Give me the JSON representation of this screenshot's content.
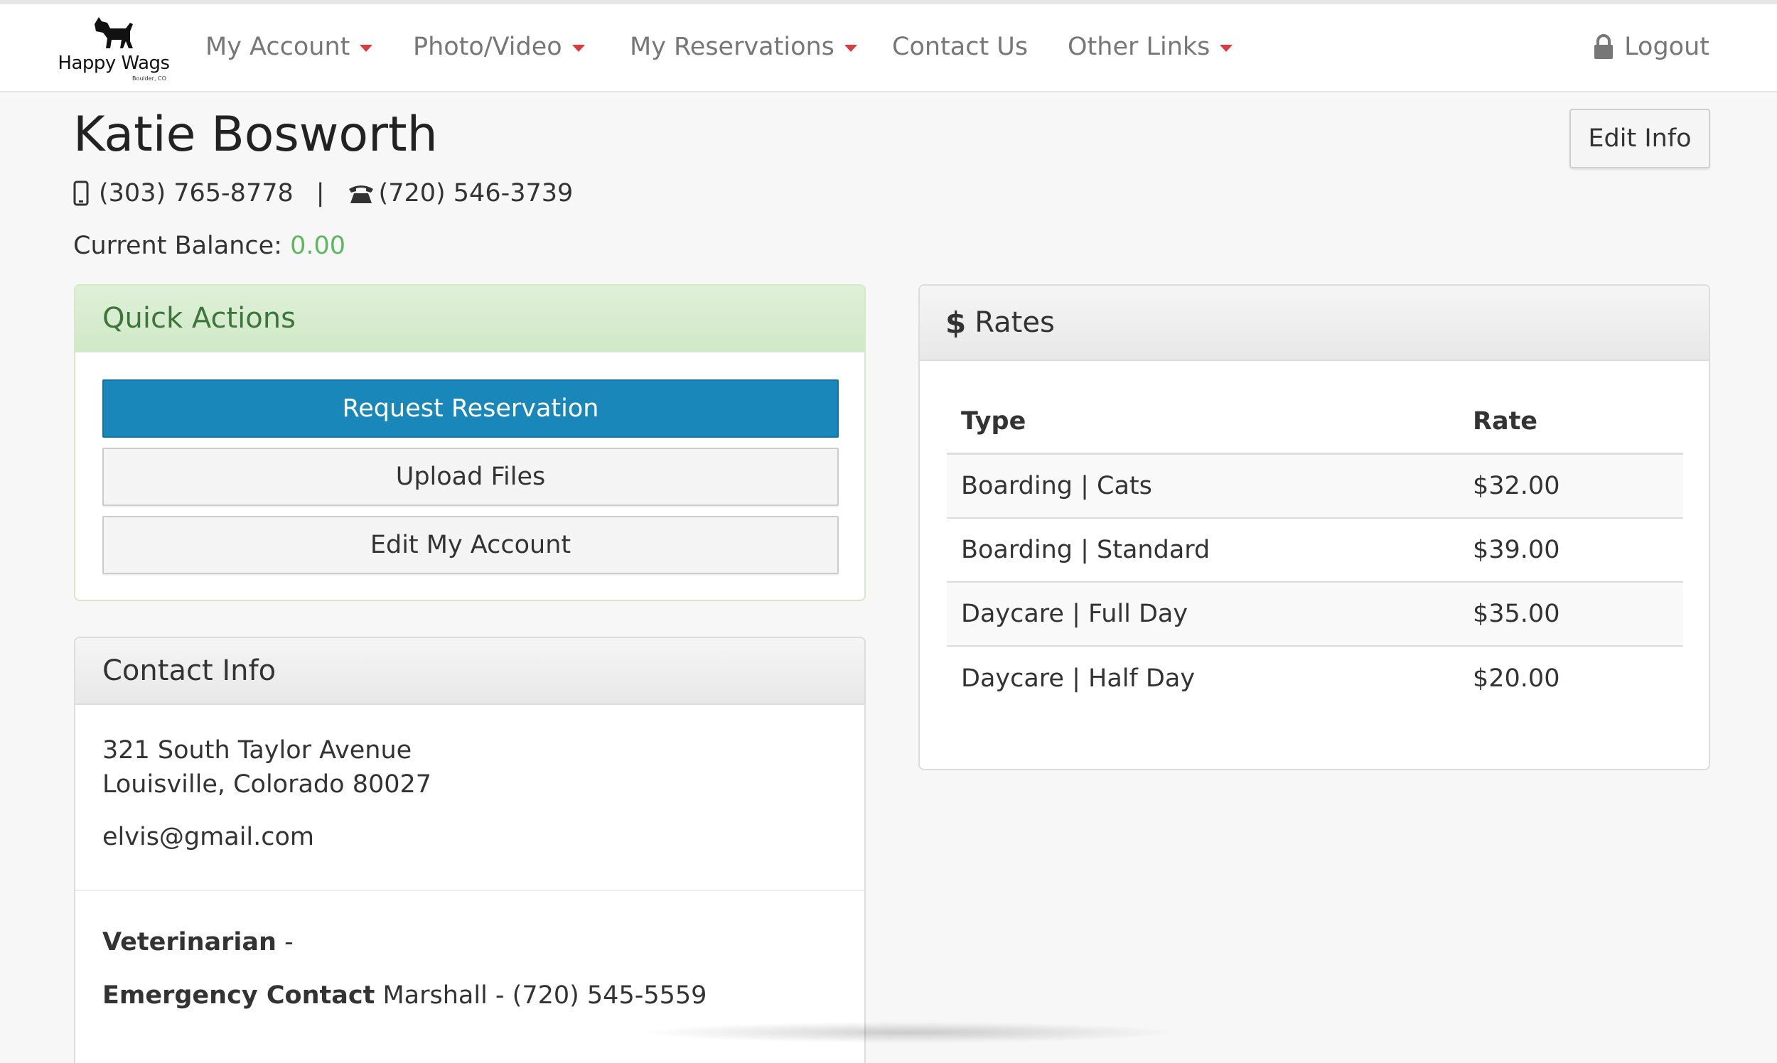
{
  "brand": {
    "name": "Happy Wags",
    "location": "Boulder, CO"
  },
  "nav": {
    "items": [
      {
        "label": "My Account",
        "dropdown": true
      },
      {
        "label": "Photo/Video",
        "dropdown": true
      },
      {
        "label": "My Reservations",
        "dropdown": true
      },
      {
        "label": "Contact Us",
        "dropdown": false
      },
      {
        "label": "Other Links",
        "dropdown": true
      }
    ],
    "logout_label": "Logout"
  },
  "customer": {
    "name": "Katie Bosworth",
    "mobile": "(303) 765-8778",
    "phone_separator": "|",
    "home": "(720) 546-3739",
    "balance_label": "Current Balance:",
    "balance_value": "0.00",
    "edit_label": "Edit Info"
  },
  "quick_actions": {
    "title": "Quick Actions",
    "buttons": [
      "Request Reservation",
      "Upload Files",
      "Edit My Account"
    ]
  },
  "contact_info": {
    "title": "Contact Info",
    "address_line1": "321 South Taylor Avenue",
    "address_line2": "Louisville, Colorado 80027",
    "email": "elvis@gmail.com",
    "vet_label": "Veterinarian",
    "vet_value": " -",
    "emergency_label": "Emergency Contact",
    "emergency_value": " Marshall - (720) 545-5559"
  },
  "rates": {
    "title": "Rates",
    "columns": [
      "Type",
      "Rate"
    ],
    "rows": [
      {
        "type": "Boarding | Cats",
        "rate": "$32.00"
      },
      {
        "type": "Boarding | Standard",
        "rate": "$39.00"
      },
      {
        "type": "Daycare | Full Day",
        "rate": "$35.00"
      },
      {
        "type": "Daycare | Half Day",
        "rate": "$20.00"
      }
    ]
  },
  "colors": {
    "primary": "#1a87bb",
    "success_text": "#3c763d",
    "balance_green": "#5cb85c",
    "caret_red": "#e0393e"
  }
}
